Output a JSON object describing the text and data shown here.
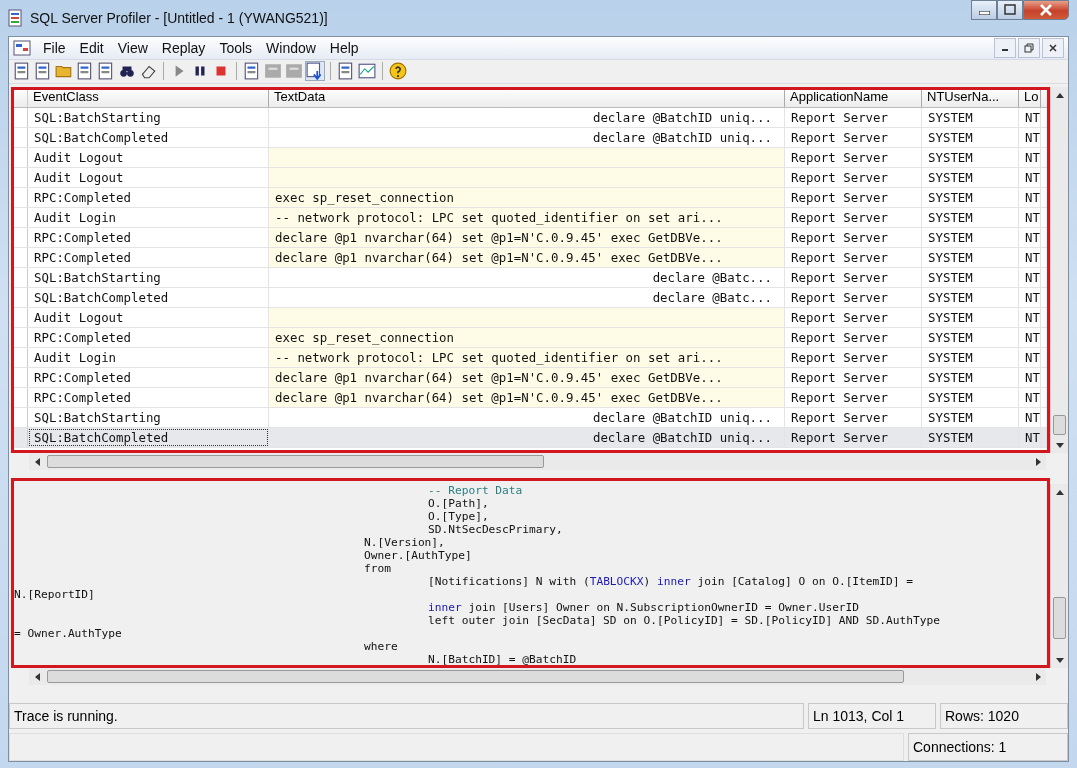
{
  "window": {
    "title": "SQL Server Profiler - [Untitled - 1 (YWANG521)]"
  },
  "menu": [
    "File",
    "Edit",
    "View",
    "Replay",
    "Tools",
    "Window",
    "Help"
  ],
  "table": {
    "columns": [
      "EventClass",
      "TextData",
      "ApplicationName",
      "NTUserNa...",
      "Lo"
    ],
    "rows": [
      {
        "kind": "batch",
        "selected": false,
        "event_class": "SQL:BatchStarting",
        "text_data": "declare @BatchID uniq...",
        "application_name": "Report Server",
        "nt_user_name": "SYSTEM",
        "column_5": "NT"
      },
      {
        "kind": "batch",
        "selected": false,
        "event_class": "SQL:BatchCompleted",
        "text_data": "declare @BatchID uniq...",
        "application_name": "Report Server",
        "nt_user_name": "SYSTEM",
        "column_5": "NT"
      },
      {
        "kind": "rpc",
        "selected": false,
        "event_class": "Audit Logout",
        "application_name": "Report Server",
        "nt_user_name": "SYSTEM",
        "column_5": "NT"
      },
      {
        "kind": "rpc",
        "selected": false,
        "event_class": "Audit Logout",
        "application_name": "Report Server",
        "nt_user_name": "SYSTEM",
        "column_5": "NT"
      },
      {
        "kind": "rpc",
        "selected": false,
        "event_class": "RPC:Completed",
        "text_data": "exec sp_reset_connection",
        "application_name": "Report Server",
        "nt_user_name": "SYSTEM",
        "column_5": "NT"
      },
      {
        "kind": "rpc",
        "selected": false,
        "event_class": "Audit Login",
        "text_data": "-- network protocol: LPC  set quoted_identifier on  set ari...",
        "application_name": "Report Server",
        "nt_user_name": "SYSTEM",
        "column_5": "NT"
      },
      {
        "kind": "rpc",
        "selected": false,
        "event_class": "RPC:Completed",
        "text_data": "declare @p1 nvarchar(64)  set @p1=N'C.0.9.45'  exec GetDBVe...",
        "application_name": "Report Server",
        "nt_user_name": "SYSTEM",
        "column_5": "NT"
      },
      {
        "kind": "rpc",
        "selected": false,
        "event_class": "RPC:Completed",
        "text_data": "declare @p1 nvarchar(64)  set @p1=N'C.0.9.45'  exec GetDBVe...",
        "application_name": "Report Server",
        "nt_user_name": "SYSTEM",
        "column_5": "NT"
      },
      {
        "kind": "batch",
        "selected": false,
        "event_class": "SQL:BatchStarting",
        "text_data": "declare @Batc...",
        "application_name": "Report Server",
        "nt_user_name": "SYSTEM",
        "column_5": "NT"
      },
      {
        "kind": "batch",
        "selected": false,
        "event_class": "SQL:BatchCompleted",
        "text_data": "declare @Batc...",
        "application_name": "Report Server",
        "nt_user_name": "SYSTEM",
        "column_5": "NT"
      },
      {
        "kind": "rpc",
        "selected": false,
        "event_class": "Audit Logout",
        "application_name": "Report Server",
        "nt_user_name": "SYSTEM",
        "column_5": "NT"
      },
      {
        "kind": "rpc",
        "selected": false,
        "event_class": "RPC:Completed",
        "text_data": "exec sp_reset_connection",
        "application_name": "Report Server",
        "nt_user_name": "SYSTEM",
        "column_5": "NT"
      },
      {
        "kind": "rpc",
        "selected": false,
        "event_class": "Audit Login",
        "text_data": "-- network protocol: LPC  set quoted_identifier on  set ari...",
        "application_name": "Report Server",
        "nt_user_name": "SYSTEM",
        "column_5": "NT"
      },
      {
        "kind": "rpc",
        "selected": false,
        "event_class": "RPC:Completed",
        "text_data": "declare @p1 nvarchar(64)  set @p1=N'C.0.9.45'  exec GetDBVe...",
        "application_name": "Report Server",
        "nt_user_name": "SYSTEM",
        "column_5": "NT"
      },
      {
        "kind": "rpc",
        "selected": false,
        "event_class": "RPC:Completed",
        "text_data": "declare @p1 nvarchar(64)  set @p1=N'C.0.9.45'  exec GetDBVe...",
        "application_name": "Report Server",
        "nt_user_name": "SYSTEM",
        "column_5": "NT"
      },
      {
        "kind": "batch",
        "selected": false,
        "event_class": "SQL:BatchStarting",
        "text_data": "declare @BatchID uniq...",
        "application_name": "Report Server",
        "nt_user_name": "SYSTEM",
        "column_5": "NT"
      },
      {
        "kind": "batch",
        "selected": true,
        "event_class": "SQL:BatchCompleted",
        "text_data": "declare @BatchID uniq...",
        "application_name": "Report Server",
        "nt_user_name": "SYSTEM",
        "column_5": "NT"
      }
    ]
  },
  "code": [
    {
      "kind": "deep",
      "segments": [
        {
          "kind": "comment",
          "text": "-- Report Data"
        }
      ]
    },
    {
      "kind": "deep",
      "segments": [
        {
          "kind": "plain",
          "text": "O.[Path],"
        }
      ]
    },
    {
      "kind": "deep",
      "segments": [
        {
          "kind": "plain",
          "text": "O.[Type],"
        }
      ]
    },
    {
      "kind": "deep",
      "segments": [
        {
          "kind": "plain",
          "text": "SD.NtSecDescPrimary,"
        }
      ]
    },
    {
      "kind": "mid",
      "segments": [
        {
          "kind": "plain",
          "text": "N.[Version],"
        }
      ]
    },
    {
      "kind": "mid",
      "segments": [
        {
          "kind": "plain",
          "text": "Owner.[AuthType]"
        }
      ]
    },
    {
      "kind": "mid",
      "segments": [
        {
          "kind": "plain",
          "text": "from"
        }
      ]
    },
    {
      "kind": "deep",
      "segments": [
        {
          "kind": "plain",
          "text": "[Notifications] N with ("
        },
        {
          "kind": "keyword",
          "text": "TABLOCKX"
        },
        {
          "kind": "plain",
          "text": ") "
        },
        {
          "kind": "keyword",
          "text": "inner"
        },
        {
          "kind": "plain",
          "text": " join [Catalog] O on O.[ItemID] ="
        }
      ]
    },
    {
      "kind": "flush",
      "segments": [
        {
          "kind": "plain",
          "text": "N.[ReportID]"
        }
      ]
    },
    {
      "kind": "deep",
      "segments": [
        {
          "kind": "keyword",
          "text": "inner"
        },
        {
          "kind": "plain",
          "text": " join [Users] Owner on N.SubscriptionOwnerID = Owner.UserID"
        }
      ]
    },
    {
      "kind": "deep",
      "segments": [
        {
          "kind": "plain",
          "text": "left outer join [SecData] SD on O.[PolicyID] = SD.[PolicyID] AND SD.AuthType"
        }
      ]
    },
    {
      "kind": "flush",
      "segments": [
        {
          "kind": "plain",
          "text": "= Owner.AuthType"
        }
      ]
    },
    {
      "kind": "mid",
      "segments": [
        {
          "kind": "plain",
          "text": "where"
        }
      ]
    },
    {
      "kind": "deep",
      "segments": [
        {
          "kind": "plain",
          "text": "N.[BatchID] = @BatchID"
        }
      ]
    }
  ],
  "status_bar": {
    "message": "Trace is running.",
    "position": "Ln 1013, Col 1",
    "rows": "Rows: 1020",
    "connections": "Connections: 1"
  }
}
